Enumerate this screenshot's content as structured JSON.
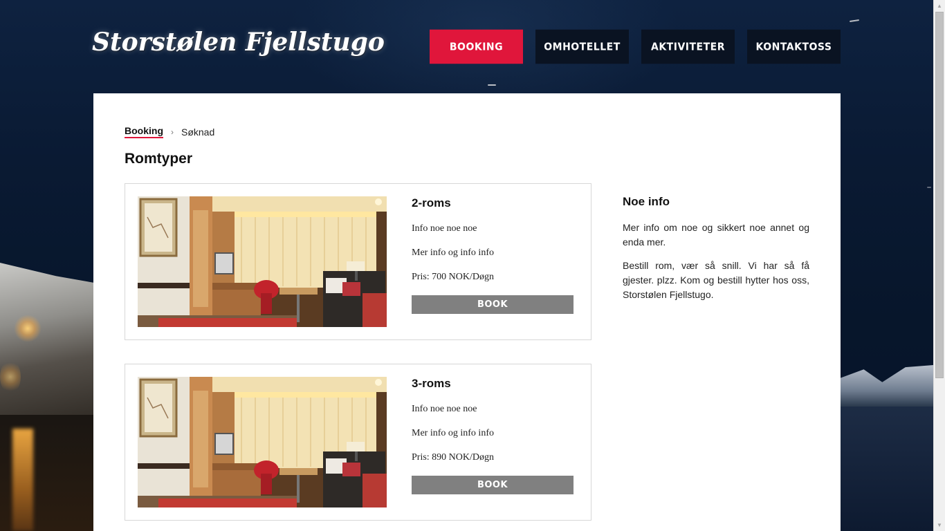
{
  "header": {
    "logo_text": "Storstølen Fjellstugo",
    "nav": [
      {
        "label": "BOOKING",
        "active": true
      },
      {
        "label": "OMHOTELLET",
        "active": false
      },
      {
        "label": "AKTIVITETER",
        "active": false
      },
      {
        "label": "KONTAKTOSS",
        "active": false
      }
    ]
  },
  "breadcrumb": {
    "link": "Booking",
    "separator": "›",
    "current": "Søknad"
  },
  "page_title": "Romtyper",
  "rooms": [
    {
      "name": "2-roms",
      "info1": "Info noe noe noe",
      "info2": "Mer info og info info",
      "price": "Pris: 700 NOK/Døgn",
      "button": "BOOK"
    },
    {
      "name": "3-roms",
      "info1": "Info noe noe noe",
      "info2": "Mer info og info info",
      "price": "Pris: 890 NOK/Døgn",
      "button": "BOOK"
    }
  ],
  "sidebar": {
    "title": "Noe info",
    "p1": "Mer info om noe og sikkert noe annet og enda mer.",
    "p2": "Bestill rom, vær så snill. Vi har så få gjester. plzz. Kom og bestill hytter hos oss, Storstølen Fjellstugo."
  },
  "colors": {
    "accent": "#e0163b",
    "nav_bg": "#0a1322",
    "button_bg": "#808080"
  }
}
